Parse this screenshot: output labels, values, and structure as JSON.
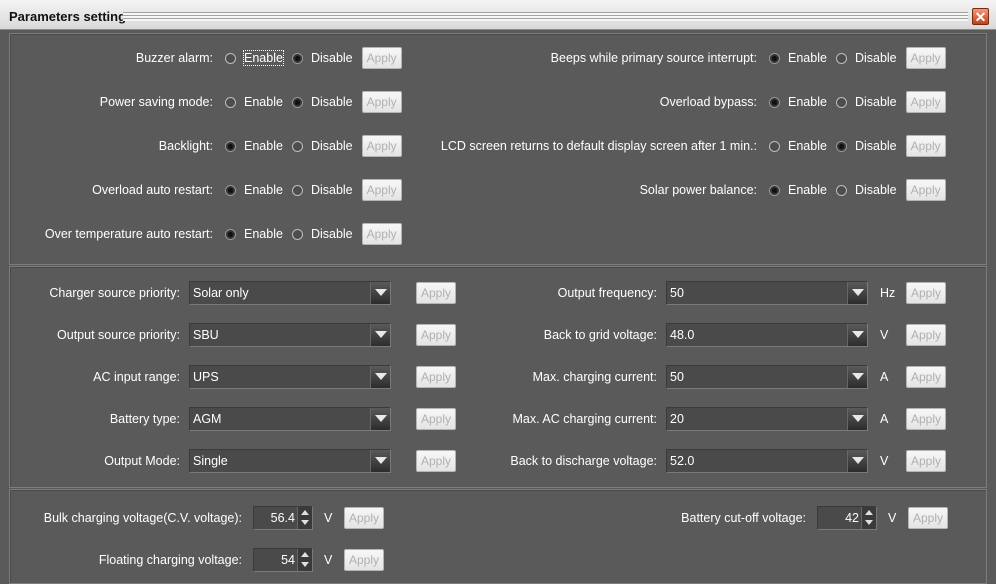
{
  "window": {
    "title": "Parameters setting",
    "close_symbol": "✕"
  },
  "apply_label": "Apply",
  "toggles": [
    {
      "label": "Buzzer alarm:",
      "enable": "Enable",
      "disable": "Disable",
      "selected": "disable"
    },
    {
      "label": "Power saving mode:",
      "enable": "Enable",
      "disable": "Disable",
      "selected": "disable"
    },
    {
      "label": "Backlight:",
      "enable": "Enable",
      "disable": "Disable",
      "selected": "enable"
    },
    {
      "label": "Overload auto restart:",
      "enable": "Enable",
      "disable": "Disable",
      "selected": "enable"
    },
    {
      "label": "Over temperature auto restart:",
      "enable": "Enable",
      "disable": "Disable",
      "selected": "enable"
    },
    {
      "label": "Beeps while primary source interrupt:",
      "enable": "Enable",
      "disable": "Disable",
      "selected": "enable"
    },
    {
      "label": "Overload bypass:",
      "enable": "Enable",
      "disable": "Disable",
      "selected": "enable"
    },
    {
      "label": "LCD screen returns to default display screen after 1 min.:",
      "enable": "Enable",
      "disable": "Disable",
      "selected": "disable"
    },
    {
      "label": "Solar power balance:",
      "enable": "Enable",
      "disable": "Disable",
      "selected": "enable"
    }
  ],
  "selects": [
    {
      "label": "Charger source priority:",
      "value": "Solar only",
      "unit": ""
    },
    {
      "label": "Output source priority:",
      "value": "SBU",
      "unit": ""
    },
    {
      "label": "AC input range:",
      "value": "UPS",
      "unit": ""
    },
    {
      "label": "Battery type:",
      "value": "AGM",
      "unit": ""
    },
    {
      "label": "Output Mode:",
      "value": "Single",
      "unit": ""
    },
    {
      "label": "Output frequency:",
      "value": "50",
      "unit": "Hz"
    },
    {
      "label": "Back to grid voltage:",
      "value": "48.0",
      "unit": "V"
    },
    {
      "label": "Max. charging current:",
      "value": "50",
      "unit": "A"
    },
    {
      "label": "Max. AC charging current:",
      "value": "20",
      "unit": "A"
    },
    {
      "label": "Back to discharge voltage:",
      "value": "52.0",
      "unit": "V"
    }
  ],
  "spinners": [
    {
      "label": "Bulk charging voltage(C.V. voltage):",
      "value": "56.4",
      "unit": "V"
    },
    {
      "label": "Floating charging voltage:",
      "value": "54",
      "unit": "V"
    },
    {
      "label": "Battery cut-off voltage:",
      "value": "42",
      "unit": "V"
    }
  ]
}
